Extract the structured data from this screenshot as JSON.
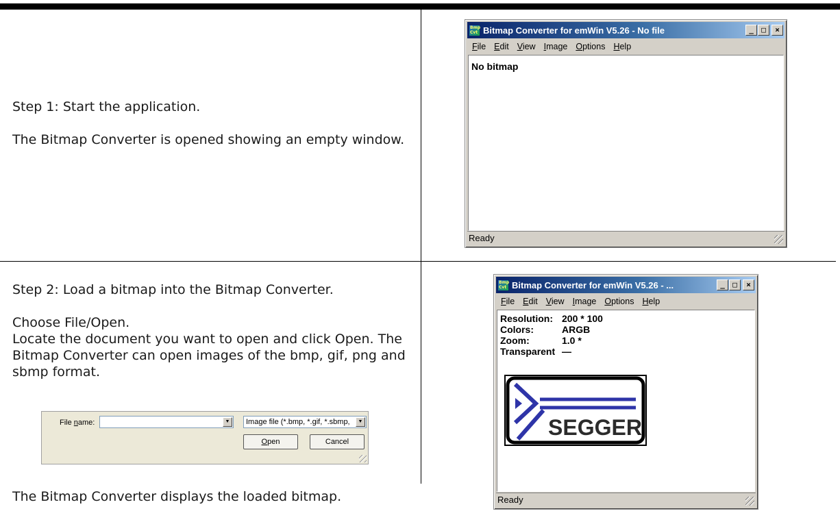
{
  "step1": {
    "heading": "Step 1: Start the application.",
    "body": "The Bitmap Converter is opened showing an empty window."
  },
  "step2": {
    "heading": "Step 2: Load a bitmap into the Bitmap Converter.",
    "para1_line1": "Choose File/Open.",
    "para1_line2": "Locate the document you want to open and click Open. The Bitmap Converter can open images of the bmp, gif, png and sbmp format.",
    "footer": "The Bitmap Converter displays the loaded bitmap."
  },
  "window1": {
    "icon_text": "Bmp Cvt",
    "title": "Bitmap Converter for emWin V5.26 - No file",
    "content": "No bitmap",
    "status": "Ready"
  },
  "window2": {
    "icon_text": "Bmp Cvt",
    "title": "Bitmap Converter for emWin V5.26 - ...",
    "info": [
      {
        "key": "Resolution:",
        "value": "200 * 100"
      },
      {
        "key": "Colors:",
        "value": "ARGB"
      },
      {
        "key": "Zoom:",
        "value": "1.0 *"
      },
      {
        "key": "Transparent",
        "value": "—"
      }
    ],
    "logo_text": "SEGGER",
    "status": "Ready"
  },
  "menu": {
    "file": "F",
    "file_rest": "ile",
    "edit": "E",
    "edit_rest": "dit",
    "view": "V",
    "view_rest": "iew",
    "image": "I",
    "image_rest": "mage",
    "options": "O",
    "options_rest": "ptions",
    "help": "H",
    "help_rest": "elp"
  },
  "caption_buttons": {
    "minimize": "_",
    "maximize": "□",
    "close": "×"
  },
  "file_dialog": {
    "filename_label_pre": "File ",
    "filename_label_u": "n",
    "filename_label_post": "ame:",
    "filename_value": "",
    "filter_value": "Image file (*.bmp, *.gif, *.sbmp,",
    "open_u": "O",
    "open_rest": "pen",
    "cancel": "Cancel"
  },
  "colors": {
    "title_gradient_start": "#0a246a",
    "title_gradient_end": "#a6caf0",
    "window_face": "#d4d0c8",
    "logo_blue": "#2e34a8"
  }
}
